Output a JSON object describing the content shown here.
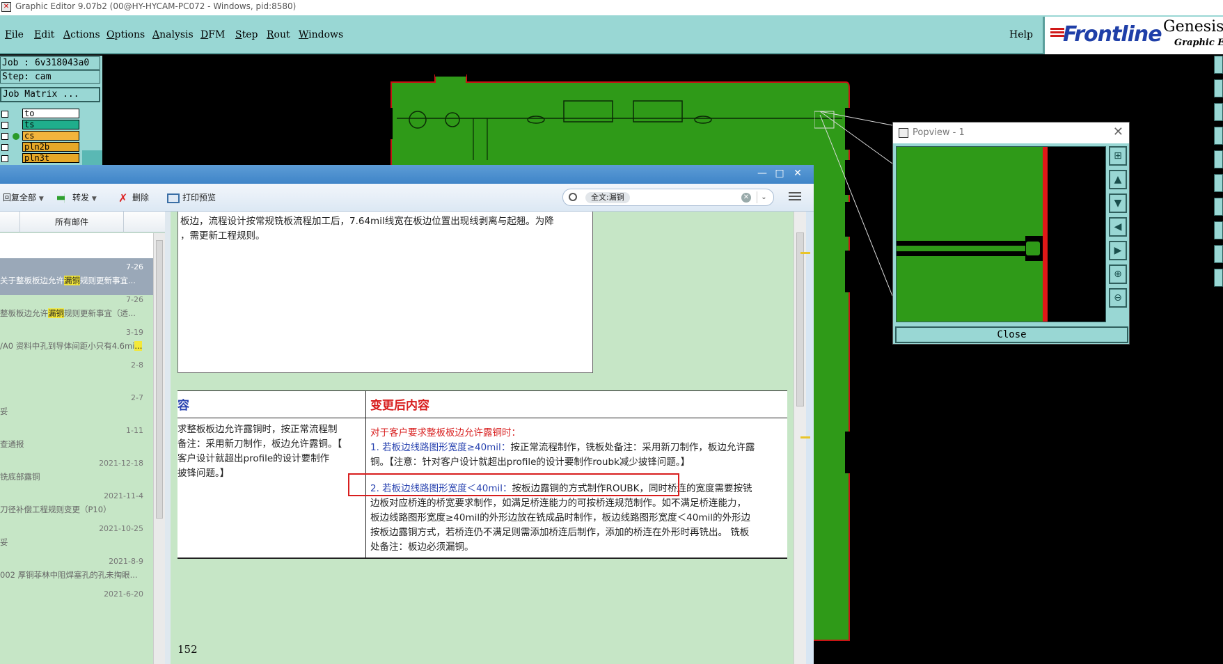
{
  "window_title": "Graphic Editor 9.07b2 (00@HY-HYCAM-PC072 - Windows, pid:8580)",
  "menu": [
    "File",
    "Edit",
    "Actions",
    "Options",
    "Analysis",
    "DFM",
    "Step",
    "Rout",
    "Windows"
  ],
  "help_label": "Help",
  "brand": {
    "logo": "Frontline",
    "product": "Genesis",
    "subtitle": "Graphic Editor"
  },
  "job": {
    "job_label": "Job : 6v318043a0",
    "step_label": "Step: cam",
    "matrix_button": "Job Matrix ..."
  },
  "layers": [
    {
      "name": "to",
      "color": "#ffffff",
      "active": false
    },
    {
      "name": "ts",
      "color": "#1fae8c",
      "active": false
    },
    {
      "name": "cs",
      "color": "#f3b43c",
      "active": true
    },
    {
      "name": "pln2b",
      "color": "#e6a828",
      "active": false
    },
    {
      "name": "pln3t",
      "color": "#e6a828",
      "active": false
    }
  ],
  "popview": {
    "title": "Popview - 1",
    "close_label": "Close",
    "tools": [
      "zoom-fit-icon",
      "pan-up-icon",
      "pan-down-icon",
      "pan-left-icon",
      "pan-right-icon",
      "zoom-in-icon",
      "zoom-out-icon"
    ]
  },
  "mail": {
    "toolbar": {
      "reply_all": "回复全部",
      "forward": "转发",
      "delete": "删除",
      "print_preview": "打印预览"
    },
    "search": {
      "tag": "全文:漏铜"
    },
    "list_header": "所有邮件",
    "items": [
      {
        "date": "7-26",
        "subject_pre": "关于整板板边允许",
        "highlight": "漏铜",
        "subject_post": "规则更新事宜...",
        "selected": true
      },
      {
        "date": "7-26",
        "subject_pre": "整板板边允许",
        "highlight": "漏铜",
        "subject_post": "规则更新事宜（适...",
        "selected": false
      },
      {
        "date": "3-19",
        "subject_pre": "/A0 资料中孔到导体间距小只有4.6mi",
        "highlight": "...",
        "subject_post": "",
        "selected": false
      },
      {
        "date": "2-8",
        "subject_pre": "",
        "highlight": "",
        "subject_post": "",
        "selected": false
      },
      {
        "date": "2-7",
        "subject_pre": "妥",
        "highlight": "",
        "subject_post": "",
        "selected": false
      },
      {
        "date": "1-11",
        "subject_pre": "查通报",
        "highlight": "",
        "subject_post": "",
        "selected": false
      },
      {
        "date": "2021-12-18",
        "subject_pre": "铣底部露铜",
        "highlight": "",
        "subject_post": "",
        "selected": false
      },
      {
        "date": "2021-11-4",
        "subject_pre": "刀径补偿工程规则变更（P10）",
        "highlight": "",
        "subject_post": "",
        "selected": false
      },
      {
        "date": "2021-10-25",
        "subject_pre": "妥",
        "highlight": "",
        "subject_post": "",
        "selected": false
      },
      {
        "date": "2021-8-9",
        "subject_pre": "002 厚铜菲林中阻焊塞孔的孔未掏眼...",
        "highlight": "",
        "subject_post": "",
        "selected": false
      },
      {
        "date": "2021-6-20",
        "subject_pre": "",
        "highlight": "",
        "subject_post": "",
        "selected": false
      }
    ],
    "body": {
      "prev_line1": "板边，流程设计按常规铣板流程加工后，7.64mil线宽在板边位置出现线剥离与起翘。为降",
      "prev_line2": "，需更新工程规则。",
      "th_left": "容",
      "th_right": "变更后内容",
      "left_lines": [
        "求整板板边允许露铜时，按正常流程制",
        "备注：采用新刀制作，板边允许露铜。【",
        "客户设计就超出profile的设计要制作",
        "披锋问题。】"
      ],
      "r_title": "对于客户要求整板板边允许露铜时：",
      "r1_blue": "1. 若板边线路图形宽度≥40mil：",
      "r1_rest": "按正常流程制作，铣板处备注：采用新刀制作，板边允许露",
      "r1_line2": "铜。【注意：针对客户设计就超出profile的设计要制作roubk减少披锋问题。】",
      "r2_blue": "2. 若板边线路图形宽度＜40mil：",
      "r2_rest": "按板边露铜的方式制作ROUBK，同时桥连的宽度需要按铣",
      "r_lines": [
        "边板对应桥连的桥宽要求制作，如满足桥连能力的可按桥连规范制作。如不满足桥连能力，",
        "板边线路图形宽度≥40mil的外形边放在铣成品时制作，板边线路图形宽度＜40mil的外形边",
        "按板边露铜方式，若桥连仍不满足则需添加桥连后制作，添加的桥连在外形时再铣出。 铣板",
        "处备注：板边必须漏铜。"
      ],
      "page_number": "152"
    }
  }
}
